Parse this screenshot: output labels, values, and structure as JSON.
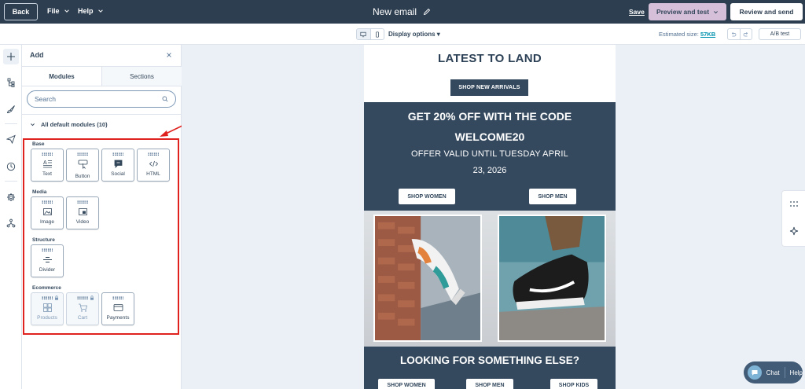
{
  "topbar": {
    "back_label": "Back",
    "file_label": "File",
    "help_label": "Help",
    "title": "New email",
    "save_label": "Save",
    "preview_label": "Preview and test",
    "review_label": "Review and send"
  },
  "toolbar": {
    "display_options_label": "Display options",
    "estimated_size_label": "Estimated size:",
    "estimated_size_value": "57KB",
    "ab_test_label": "A/B test"
  },
  "panel": {
    "title": "Add",
    "tabs": [
      "Modules",
      "Sections"
    ],
    "search_placeholder": "Search",
    "accordion_label": "All default modules (10)",
    "groups": {
      "base": "Base",
      "media": "Media",
      "structure": "Structure",
      "ecommerce": "Ecommerce"
    },
    "modules": {
      "text": "Text",
      "button": "Button",
      "social": "Social",
      "html": "HTML",
      "image": "Image",
      "video": "Video",
      "divider": "Divider",
      "products": "Products",
      "cart": "Cart",
      "payments": "Payments"
    }
  },
  "email": {
    "title": "LATEST TO LAND",
    "shop_new_arrivals": "SHOP NEW ARRIVALS",
    "promo_line1": "GET 20% OFF WITH THE CODE",
    "promo_line2": "WELCOME20",
    "promo_line3": "OFFER VALID UNTIL TUESDAY APRIL",
    "promo_line4": "23, 2026",
    "shop_women": "SHOP WOMEN",
    "shop_men": "SHOP MEN",
    "footer_heading": "LOOKING FOR SOMETHING ELSE?",
    "footer_shop_women": "SHOP WOMEN",
    "footer_shop_men": "SHOP MEN",
    "footer_shop_kids": "SHOP KIDS"
  },
  "chat": {
    "chat_label": "Chat",
    "help_label": "Help"
  },
  "colors": {
    "topbar": "#2d3e50",
    "preview_button": "#d6bfd9",
    "email_dark": "#34495e",
    "highlight": "#e0221f"
  }
}
